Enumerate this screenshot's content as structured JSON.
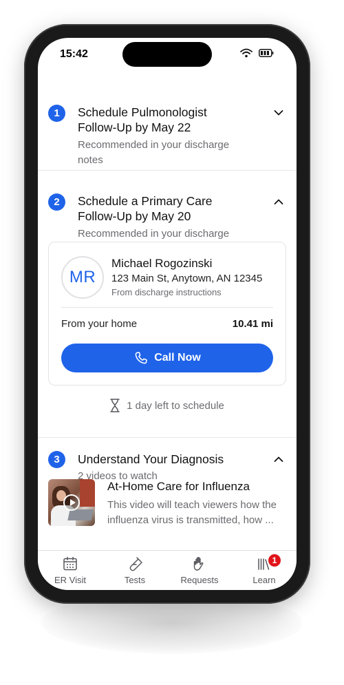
{
  "status_bar": {
    "time": "15:42"
  },
  "steps": [
    {
      "number": "1",
      "title": "Schedule Pulmonologist Follow-Up by May 22",
      "subtitle": "Recommended in your discharge notes",
      "expanded": false
    },
    {
      "number": "2",
      "title": "Schedule a Primary Care Follow-Up by May 20",
      "subtitle": "Recommended in your discharge notes",
      "expanded": true,
      "provider": {
        "initials": "MR",
        "name": "Michael Rogozinski",
        "address": "123 Main St, Anytown, AN 12345",
        "source": "From discharge instructions",
        "distance_label": "From your home",
        "distance_value": "10.41 mi",
        "call_label": "Call Now"
      },
      "time_left": "1 day left to schedule"
    },
    {
      "number": "3",
      "title": "Understand Your Diagnosis",
      "subtitle": "2 videos to watch",
      "expanded": true,
      "video": {
        "title": "At-Home Care for Influenza",
        "description": "This video will teach viewers how the influenza virus is transmitted, how ..."
      }
    }
  ],
  "tabbar": {
    "tabs": [
      {
        "label": "ER Visit",
        "icon": "calendar-icon"
      },
      {
        "label": "Tests",
        "icon": "test-tube-icon"
      },
      {
        "label": "Requests",
        "icon": "hand-icon"
      },
      {
        "label": "Learn",
        "icon": "library-icon",
        "badge": "1"
      }
    ]
  },
  "colors": {
    "accent": "#1f63e9",
    "badge": "#e0151a",
    "muted_text": "#6b6b70"
  }
}
